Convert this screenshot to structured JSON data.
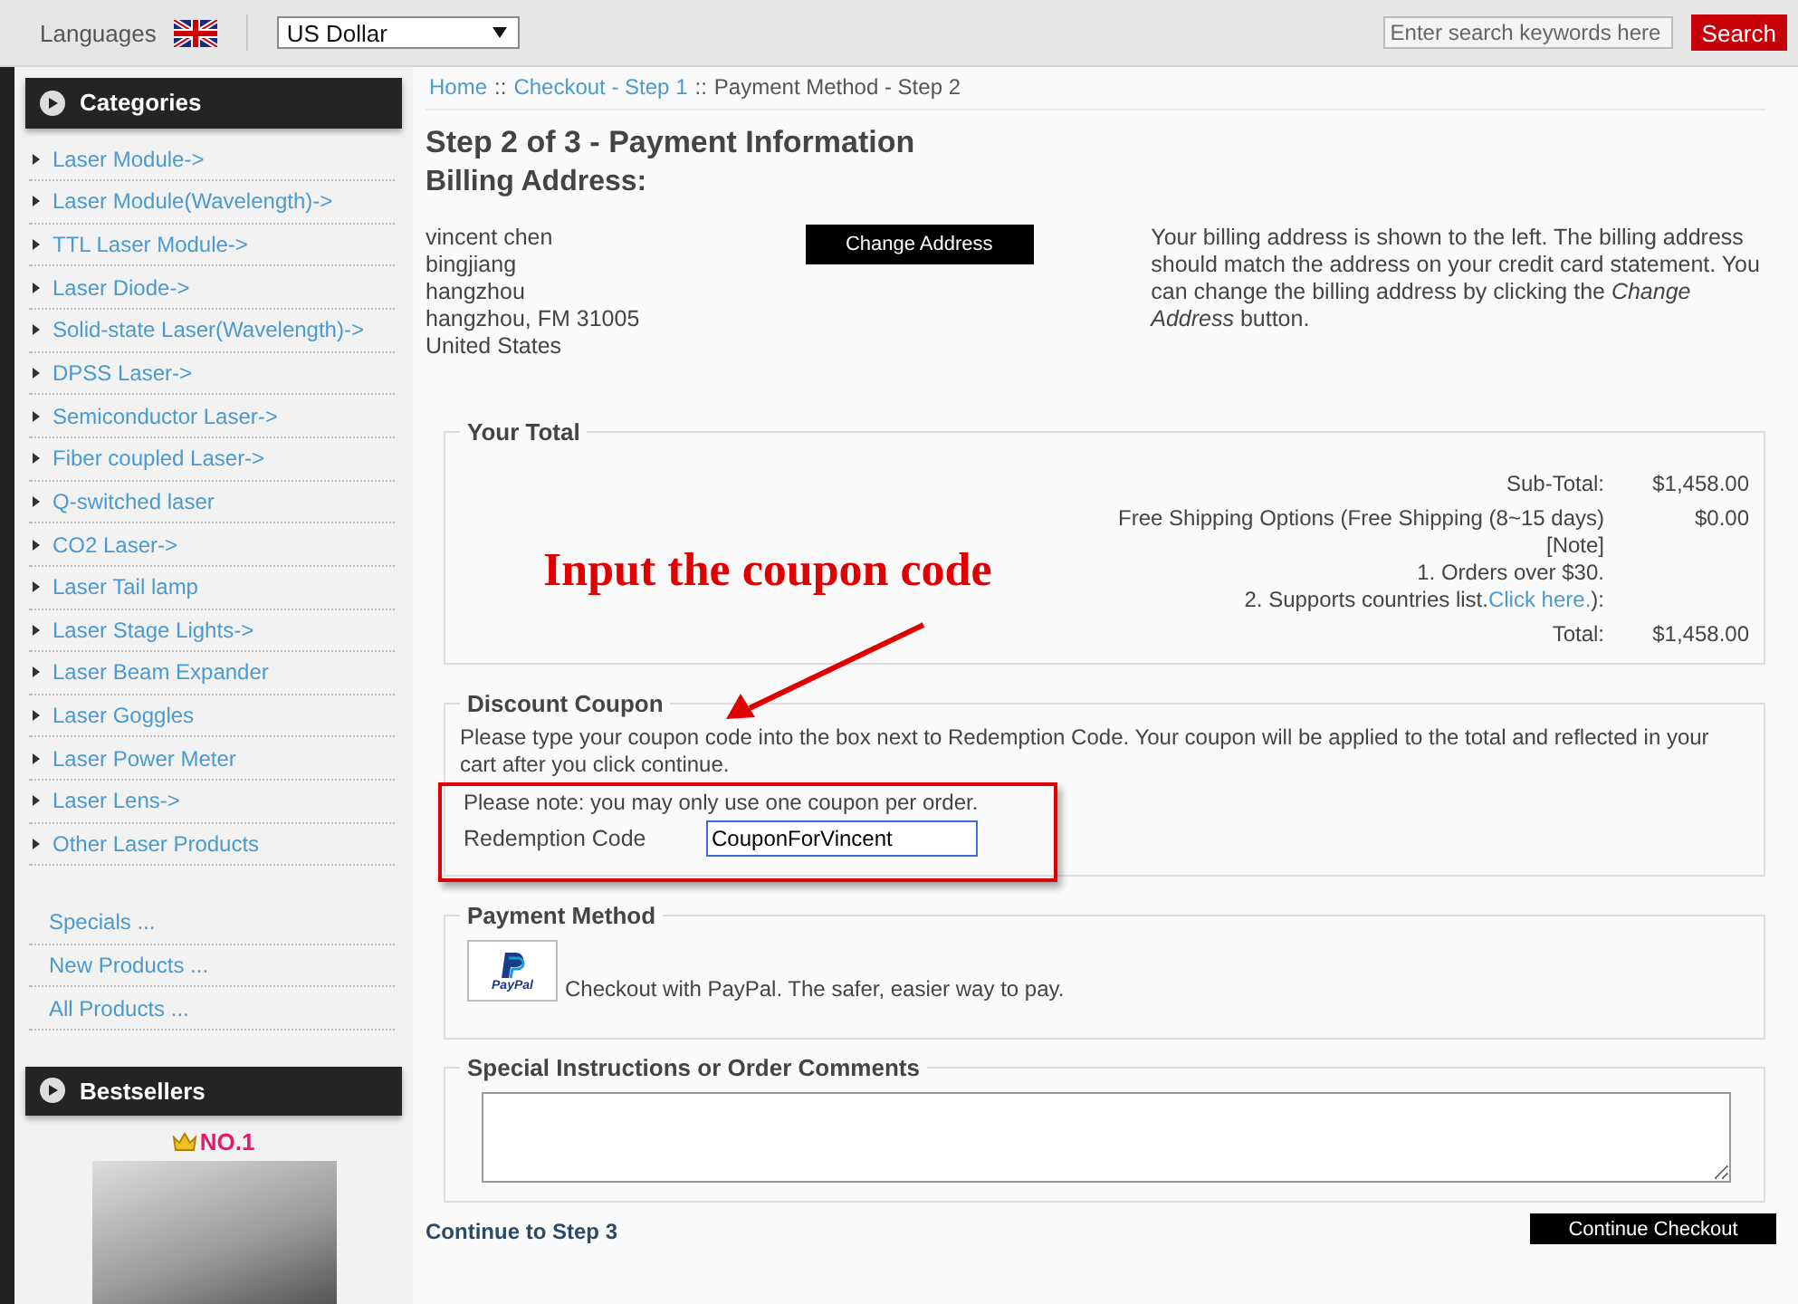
{
  "header": {
    "languages_label": "Languages",
    "currency": "US Dollar",
    "search": {
      "placeholder": "Enter search keywords here",
      "button": "Search"
    }
  },
  "sidebar": {
    "categories": {
      "title": "Categories",
      "items": [
        "Laser Module->",
        "Laser Module(Wavelength)->",
        "TTL Laser Module->",
        "Laser Diode->",
        "Solid-state Laser(Wavelength)->",
        "DPSS Laser->",
        "Semiconductor Laser->",
        "Fiber coupled Laser->",
        "Q-switched laser",
        "CO2 Laser->",
        "Laser Tail lamp",
        "Laser Stage Lights->",
        "Laser Beam Expander",
        "Laser Goggles",
        "Laser Power Meter",
        "Laser Lens->",
        "Other Laser Products"
      ]
    },
    "links": [
      "Specials ...",
      "New Products ...",
      "All Products ..."
    ],
    "bestsellers": {
      "title": "Bestsellers",
      "rank": "NO.1"
    }
  },
  "breadcrumb": {
    "separator": "::",
    "items": [
      {
        "label": "Home",
        "link": true
      },
      {
        "label": "Checkout - Step 1",
        "link": true
      },
      {
        "label": "Payment Method - Step 2",
        "link": false
      }
    ]
  },
  "page_title": "Step 2 of 3 - Payment Information",
  "billing": {
    "heading": "Billing Address:",
    "address_lines": [
      "vincent chen",
      "bingjiang",
      "hangzhou",
      "hangzhou, FM 31005",
      "United States"
    ],
    "button": "Change Address",
    "explanation": "Your billing address is shown to the left. The billing address should match the address on your credit card statement. You can change the billing address by clicking the *Change Address* button."
  },
  "total": {
    "legend": "Your Total",
    "rows": [
      {
        "label_lines": [
          "Sub-Total:"
        ],
        "amount": "$1,458.00"
      },
      {
        "label_lines": [
          "Free Shipping Options (Free Shipping (8~15 days)",
          "[Note]",
          "1. Orders over $30.",
          "2. Supports countries list."
        ],
        "link": "Click here.",
        "tail": "):",
        "amount": "$0.00"
      },
      {
        "label_lines": [
          "Total:"
        ],
        "amount": "$1,458.00"
      }
    ]
  },
  "coupon": {
    "legend": "Discount Coupon",
    "instructions": "Please type your coupon code into the box next to Redemption Code. Your coupon will be applied to the total and reflected in your cart after you click continue.",
    "note": "Please note: you may only use one coupon per order.",
    "field_label": "Redemption Code",
    "value": "CouponForVincent"
  },
  "payment": {
    "legend": "Payment Method",
    "logo_text": "PayPal",
    "text": "Checkout with PayPal. The safer, easier way to pay."
  },
  "comments": {
    "legend": "Special Instructions or Order Comments"
  },
  "footer": {
    "continue_text": "Continue to Step 3",
    "button": "Continue Checkout"
  },
  "annotation": {
    "text": "Input the coupon code"
  }
}
